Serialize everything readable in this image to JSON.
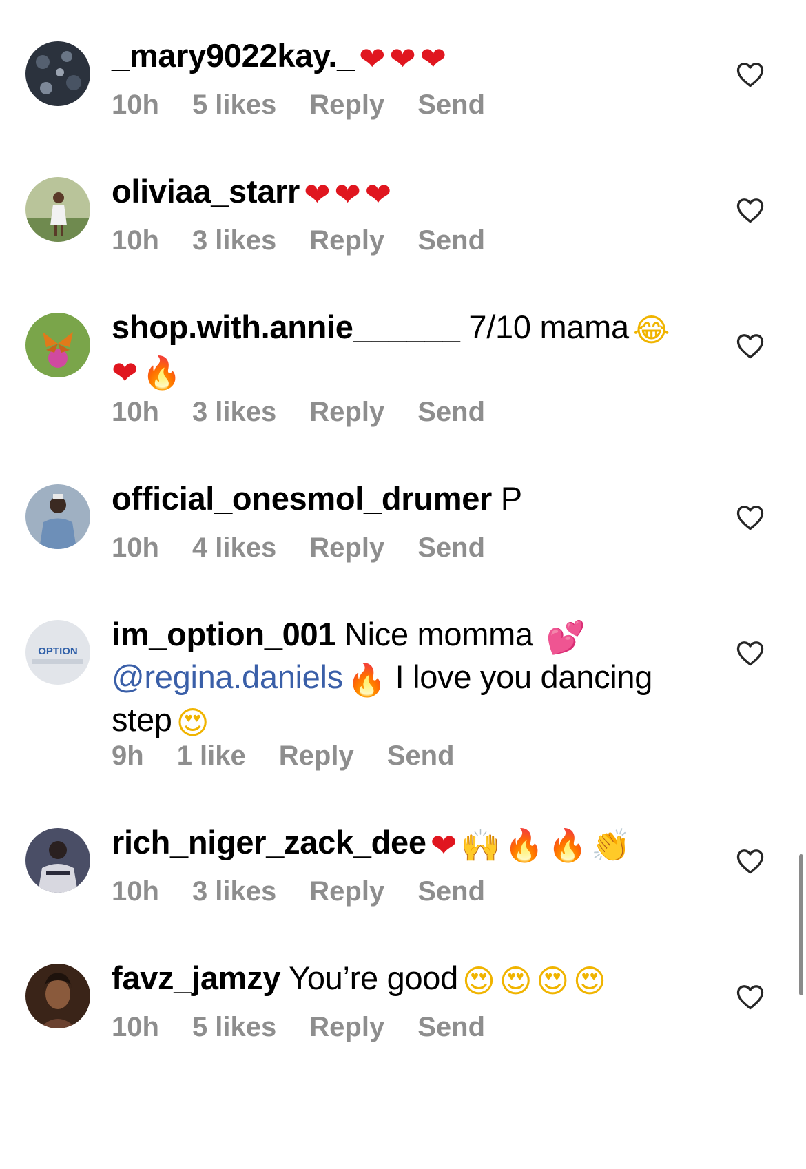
{
  "comments": [
    {
      "username": "_mary9022kay._",
      "text": "",
      "emojis": [
        {
          "char": "❤",
          "cls": "heart-e"
        },
        {
          "char": "❤",
          "cls": "heart-e"
        },
        {
          "char": "❤",
          "cls": "heart-e"
        }
      ],
      "time": "10h",
      "likes": "5 likes",
      "reply": "Reply",
      "send": "Send",
      "avatar_color": "#2e3440",
      "avatar_icon": "butterflies-avatar"
    },
    {
      "username": "oliviaa_starr",
      "text": "",
      "emojis": [
        {
          "char": "❤",
          "cls": "heart-e"
        },
        {
          "char": "❤",
          "cls": "heart-e"
        },
        {
          "char": "❤",
          "cls": "heart-e"
        }
      ],
      "time": "10h",
      "likes": "3 likes",
      "reply": "Reply",
      "send": "Send",
      "avatar_color": "#9aa77a",
      "avatar_icon": "person-outdoor-avatar"
    },
    {
      "username": "shop.with.annie______",
      "text": " 7/10 mama",
      "emojis": [
        {
          "char": "😂",
          "cls": "face"
        },
        {
          "char": "❤",
          "cls": "heart-e"
        },
        {
          "char": "🔥",
          "cls": "fire"
        }
      ],
      "time": "10h",
      "likes": "3 likes",
      "reply": "Reply",
      "send": "Send",
      "avatar_color": "#6f9a3c",
      "avatar_icon": "butterfly-flower-avatar"
    },
    {
      "username": "official_onesmol_drumer",
      "text": " P",
      "emojis": [],
      "time": "10h",
      "likes": "4 likes",
      "reply": "Reply",
      "send": "Send",
      "avatar_color": "#7c8ea3",
      "avatar_icon": "person-denim-avatar"
    },
    {
      "username": "im_option_001",
      "text": " Nice momma ",
      "mention": "@regina.daniels",
      "text2": " I love you dancing step",
      "emojis": [],
      "time": "9h",
      "likes": "1 like",
      "reply": "Reply",
      "send": "Send",
      "avatar_color": "#dfe3e8",
      "avatar_icon": "option-logo-avatar",
      "avatar_text": "OPTION"
    },
    {
      "username": "rich_niger_zack_dee",
      "text": "",
      "emojis": [
        {
          "char": "❤",
          "cls": "heart-e"
        },
        {
          "char": "🙌",
          "cls": "hands"
        },
        {
          "char": "🔥",
          "cls": "fire"
        },
        {
          "char": "🔥",
          "cls": "fire"
        },
        {
          "char": "👏",
          "cls": "hands"
        }
      ],
      "time": "10h",
      "likes": "3 likes",
      "reply": "Reply",
      "send": "Send",
      "avatar_color": "#3b3f55",
      "avatar_icon": "person-dark-avatar"
    },
    {
      "username": "favz_jamzy",
      "text": " You’re good",
      "emojis": [
        {
          "char": "😍",
          "cls": "face"
        },
        {
          "char": "😍",
          "cls": "face"
        },
        {
          "char": "😍",
          "cls": "face"
        },
        {
          "char": "😍",
          "cls": "face"
        }
      ],
      "time": "10h",
      "likes": "5 likes",
      "reply": "Reply",
      "send": "Send",
      "avatar_color": "#5a3422",
      "avatar_icon": "portrait-avatar"
    }
  ]
}
